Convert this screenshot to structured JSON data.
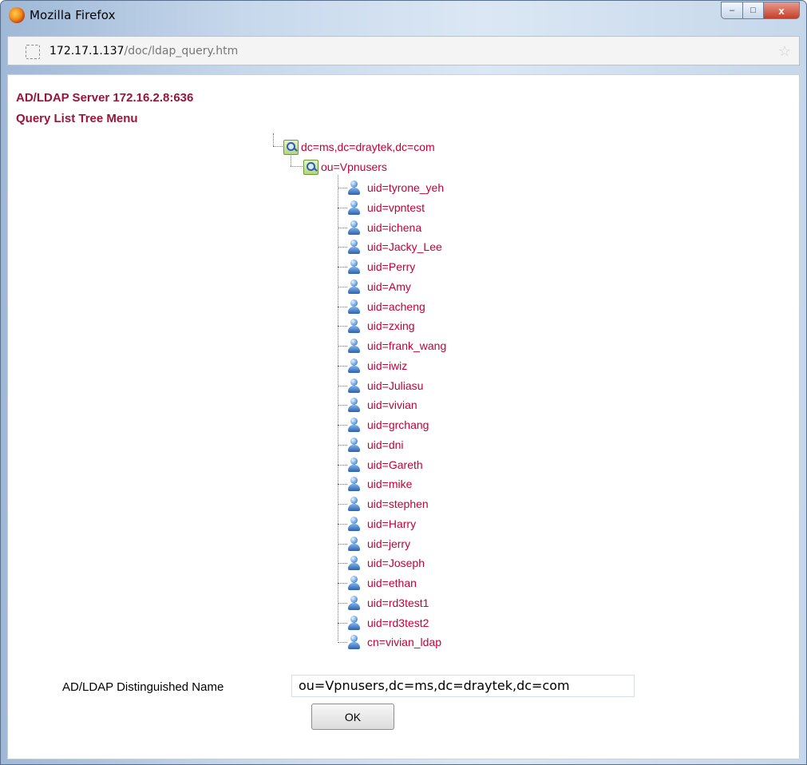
{
  "window": {
    "title": "Mozilla Firefox",
    "minimize": "–",
    "maximize": "□",
    "close": "x"
  },
  "address_bar": {
    "host": "172.17.1.137",
    "path": "/doc/ldap_query.htm",
    "bookmark_star": "☆"
  },
  "page": {
    "server_heading": "AD/LDAP Server 172.16.2.8:636",
    "tree_heading": "Query List Tree Menu",
    "tree": {
      "root": "dc=ms,dc=draytek,dc=com",
      "ou": "ou=Vpnusers",
      "entries": [
        "uid=tyrone_yeh",
        "uid=vpntest",
        "uid=ichena",
        "uid=Jacky_Lee",
        "uid=Perry",
        "uid=Amy",
        "uid=acheng",
        "uid=zxing",
        "uid=frank_wang",
        "uid=iwiz",
        "uid=Juliasu",
        "uid=vivian",
        "uid=grchang",
        "uid=dni",
        "uid=Gareth",
        "uid=mike",
        "uid=stephen",
        "uid=Harry",
        "uid=jerry",
        "uid=Joseph",
        "uid=ethan",
        "uid=rd3test1",
        "uid=rd3test2",
        "cn=vivian_ldap"
      ]
    },
    "dn_label": "AD/LDAP Distinguished Name",
    "dn_value": "ou=Vpnusers,dc=ms,dc=draytek,dc=com",
    "ok_label": "OK"
  }
}
